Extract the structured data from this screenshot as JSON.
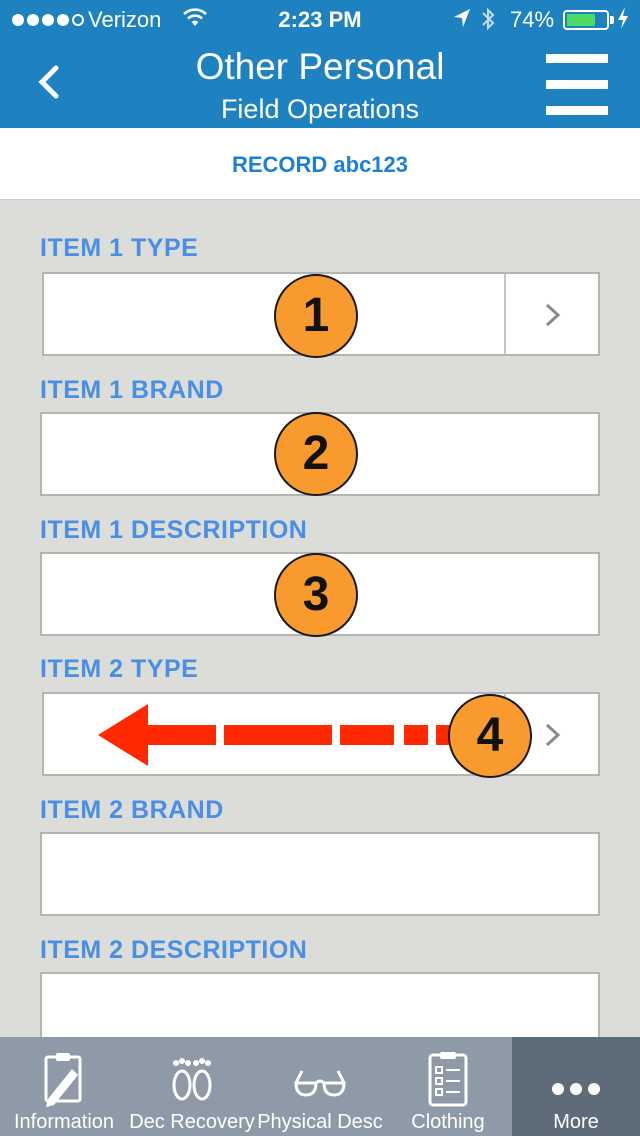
{
  "status": {
    "carrier": "Verizon",
    "time": "2:23 PM",
    "battery_pct": "74%",
    "battery_level": 0.74,
    "signal_bars_filled": 4,
    "signal_bars_total": 5
  },
  "header": {
    "title": "Other Personal",
    "subtitle": "Field Operations",
    "color": "#1f82c0"
  },
  "record": {
    "label": "RECORD abc123"
  },
  "form": {
    "fields": [
      {
        "label": "ITEM 1 TYPE",
        "value": "",
        "badge": "1"
      },
      {
        "label": "ITEM 1 BRAND",
        "value": "",
        "badge": "2"
      },
      {
        "label": "ITEM 1 DESCRIPTION",
        "value": "",
        "badge": "3"
      },
      {
        "label": "ITEM 2 TYPE",
        "value": "",
        "badge": "4"
      },
      {
        "label": "ITEM 2 BRAND",
        "value": ""
      },
      {
        "label": "ITEM 2 DESCRIPTION",
        "value": ""
      }
    ]
  },
  "tabs": [
    {
      "label": "Information",
      "icon": "clipboard-edit-icon"
    },
    {
      "label": "Dec Recovery",
      "icon": "footprints-icon"
    },
    {
      "label": "Physical Desc",
      "icon": "glasses-icon"
    },
    {
      "label": "Clothing",
      "icon": "checklist-icon"
    },
    {
      "label": "More",
      "icon": "more-dots-icon",
      "active": true
    }
  ],
  "colors": {
    "accent": "#1f82c0",
    "label_blue": "#4a8fe6",
    "badge_orange": "#f89a2e",
    "arrow_red": "#ff2a00",
    "tabbar": "#8e9aa7",
    "tab_active": "#5e6b79"
  }
}
